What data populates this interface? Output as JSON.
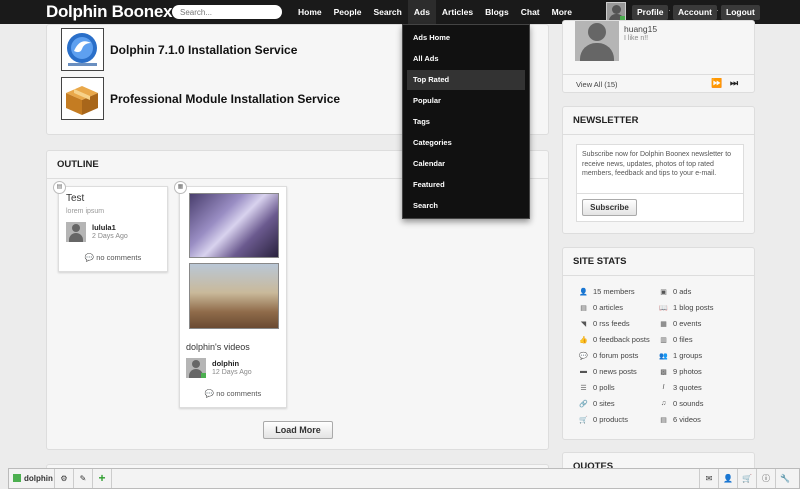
{
  "header": {
    "site_name": "Dolphin Boonex",
    "search_placeholder": "Search...",
    "nav": [
      "Home",
      "People",
      "Search",
      "Ads",
      "Articles",
      "Blogs",
      "Chat",
      "More"
    ],
    "active_nav": "Ads",
    "profile_label": "Profile",
    "account_label": "Account",
    "logout_label": "Logout"
  },
  "ads_menu": {
    "items": [
      "Ads Home",
      "All Ads",
      "Top Rated",
      "Popular",
      "Tags",
      "Categories",
      "Calendar",
      "Featured",
      "Search"
    ],
    "highlighted": "Top Rated"
  },
  "services": [
    {
      "title": "Dolphin 7.1.0 Installation Service",
      "icon": "dolphin-logo-icon"
    },
    {
      "title": "Professional Module Installation Service",
      "icon": "package-box-icon"
    }
  ],
  "outline": {
    "title": "OUTLINE",
    "posts": [
      {
        "title": "Test",
        "snippet": "lorem ipsum",
        "author": "lulula1",
        "time": "2 Days Ago",
        "comments": "no comments"
      },
      {
        "title": "dolphin's videos",
        "author": "dolphin",
        "time": "12 Days Ago",
        "comments": "no comments"
      }
    ],
    "load_more": "Load More"
  },
  "member_widget": {
    "name": "huang15",
    "status": "I like n!!",
    "view_all": "View All (15)"
  },
  "newsletter": {
    "title": "NEWSLETTER",
    "text": "Subscribe now for Dolphin Boonex newsletter to receive news, updates, photos of top rated members, feedback and tips to your e-mail.",
    "button": "Subscribe"
  },
  "site_stats": {
    "title": "SITE STATS",
    "left": [
      {
        "icon": "user-icon",
        "label": "15 members"
      },
      {
        "icon": "article-icon",
        "label": "0 articles"
      },
      {
        "icon": "rss-icon",
        "label": "0 rss feeds"
      },
      {
        "icon": "thumbs-up-icon",
        "label": "0 feedback posts"
      },
      {
        "icon": "comments-icon",
        "label": "0 forum posts"
      },
      {
        "icon": "news-icon",
        "label": "0 news posts"
      },
      {
        "icon": "poll-icon",
        "label": "0 polls"
      },
      {
        "icon": "link-icon",
        "label": "0 sites"
      },
      {
        "icon": "cart-icon",
        "label": "0 products"
      }
    ],
    "right": [
      {
        "icon": "ads-icon",
        "label": "0 ads"
      },
      {
        "icon": "book-icon",
        "label": "1 blog posts"
      },
      {
        "icon": "calendar-icon",
        "label": "0 events"
      },
      {
        "icon": "file-icon",
        "label": "0 files"
      },
      {
        "icon": "group-icon",
        "label": "1 groups"
      },
      {
        "icon": "photo-icon",
        "label": "9 photos"
      },
      {
        "icon": "quote-icon",
        "label": "3 quotes"
      },
      {
        "icon": "music-icon",
        "label": "0 sounds"
      },
      {
        "icon": "video-icon",
        "label": "6 videos"
      }
    ]
  },
  "quotes": {
    "title": "QUOTES"
  },
  "bottom_bar": {
    "username": "dolphin"
  },
  "colors": {
    "topbar": "#1a1a1a",
    "online": "#4caf50",
    "accent_plus": "#2e9e2e"
  }
}
